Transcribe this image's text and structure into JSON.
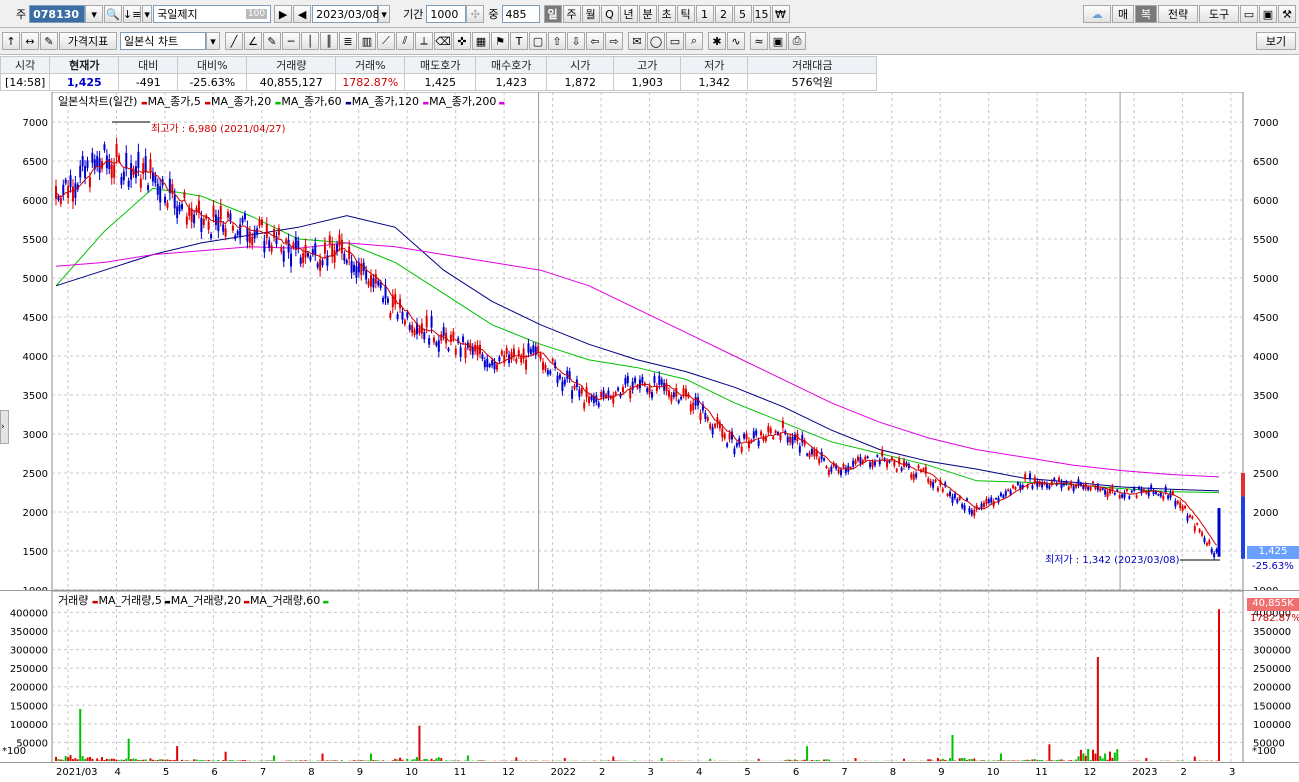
{
  "toolbar1": {
    "market_prefix": "주",
    "code": "078130",
    "name": "국일제지",
    "name_badge": "100",
    "date": "2023/03/08",
    "period_label": "기간",
    "period": "1000",
    "count_label": "중",
    "count": "485",
    "timeframes": [
      "일",
      "주",
      "월",
      "Q",
      "년",
      "분",
      "초",
      "틱",
      "1",
      "2",
      "5",
      "15",
      "₩"
    ],
    "active_timeframe": "일",
    "right_buttons": {
      "cloud": "☁",
      "sell": "매",
      "dup": "복",
      "strategy": "전략",
      "tools": "도구"
    }
  },
  "toolbar2": {
    "indicator_btn": "가격지표",
    "chart_type": "일본식 차트",
    "view_btn": "보기"
  },
  "quote": {
    "headers": [
      "시각",
      "현재가",
      "대비",
      "대비%",
      "거래량",
      "거래%",
      "매도호가",
      "매수호가",
      "시가",
      "고가",
      "저가",
      "거래대금"
    ],
    "values": [
      "[14:58]",
      "1,425",
      "-491",
      "-25.63%",
      "40,855,127",
      "1782.87%",
      "1,425",
      "1,423",
      "1,872",
      "1,903",
      "1,342",
      "576억원"
    ]
  },
  "price_panel": {
    "legend_title": "일본식차트(일간)",
    "legend_items": [
      {
        "label": "MA_종가,5",
        "color": "#d00000"
      },
      {
        "label": "MA_종가,20",
        "color": "#d00000"
      },
      {
        "label": "MA_종가,60",
        "color": "#00c000"
      },
      {
        "label": "MA_종가,120",
        "color": "#000080"
      },
      {
        "label": "MA_종가,200",
        "color": "#e000e0"
      }
    ],
    "high_annotation": "최고가 : 6,980 (2021/04/27)",
    "low_annotation": "최저가 : 1,342 (2023/03/08)",
    "y_ticks": [
      7000,
      6500,
      6000,
      5500,
      5000,
      4500,
      4000,
      3500,
      3000,
      2500,
      2000,
      1500,
      1000
    ],
    "current_price_tag": "1,425",
    "current_change_tag": "-25.63%"
  },
  "volume_panel": {
    "legend_title": "거래량",
    "legend_items": [
      {
        "label": "MA_거래량,5",
        "color": "#d00000"
      },
      {
        "label": "MA_거래량,20",
        "color": "#000000"
      },
      {
        "label": "MA_거래량,60",
        "color": "#d00000"
      },
      {
        "label": "",
        "color": "#00c000"
      }
    ],
    "y_ticks": [
      400000,
      350000,
      300000,
      250000,
      200000,
      150000,
      100000,
      50000
    ],
    "unit_label": "*100",
    "volume_tag": "40,855K",
    "volume_pct_tag": "1782.87%"
  },
  "x_axis": {
    "labels": [
      "2021/03",
      "4",
      "5",
      "6",
      "7",
      "8",
      "9",
      "10",
      "11",
      "12",
      "2022",
      "2",
      "3",
      "4",
      "5",
      "6",
      "7",
      "8",
      "9",
      "10",
      "11",
      "12",
      "2023",
      "2",
      "3"
    ]
  },
  "colors": {
    "up": "#e00000",
    "down": "#0000cc",
    "ma5": "#d00000",
    "ma60": "#00c000",
    "ma120": "#000080",
    "ma200": "#e000e0",
    "grid": "#c8c8c8"
  },
  "chart_data": {
    "type": "line",
    "title": "",
    "xlabel": "",
    "ylabel": "",
    "ylim": [
      1000,
      7000
    ],
    "x": [
      "2021/03",
      "2021/04",
      "2021/05",
      "2021/06",
      "2021/07",
      "2021/08",
      "2021/09",
      "2021/10",
      "2021/11",
      "2021/12",
      "2022/01",
      "2022/02",
      "2022/03",
      "2022/04",
      "2022/05",
      "2022/06",
      "2022/07",
      "2022/08",
      "2022/09",
      "2022/10",
      "2022/11",
      "2022/12",
      "2023/01",
      "2023/02",
      "2023/03"
    ],
    "series": [
      {
        "name": "종가",
        "values": [
          6100,
          6500,
          6300,
          5700,
          5650,
          5300,
          5350,
          4600,
          4200,
          3950,
          4000,
          3400,
          3650,
          3500,
          2850,
          3050,
          2550,
          2700,
          2450,
          2000,
          2400,
          2350,
          2250,
          2250,
          1425
        ]
      },
      {
        "name": "MA_종가,60",
        "values": [
          4900,
          5600,
          6150,
          6050,
          5800,
          5500,
          5450,
          5200,
          4800,
          4400,
          4150,
          3950,
          3850,
          3700,
          3400,
          3150,
          2900,
          2750,
          2600,
          2400,
          2380,
          2350,
          2300,
          2260,
          2250
        ]
      },
      {
        "name": "MA_종가,120",
        "values": [
          4900,
          5100,
          5300,
          5450,
          5550,
          5650,
          5800,
          5650,
          5100,
          4700,
          4400,
          4150,
          3950,
          3800,
          3600,
          3350,
          3050,
          2800,
          2650,
          2550,
          2430,
          2380,
          2320,
          2290,
          2270
        ]
      },
      {
        "name": "MA_종가,200",
        "values": [
          5150,
          5200,
          5300,
          5350,
          5400,
          5380,
          5450,
          5400,
          5300,
          5200,
          5100,
          4900,
          4600,
          4300,
          4000,
          3700,
          3400,
          3150,
          2950,
          2800,
          2700,
          2600,
          2530,
          2480,
          2450
        ]
      }
    ],
    "volume": {
      "unit": "*100",
      "ylim": [
        0,
        420000
      ],
      "values": [
        140000,
        60000,
        40000,
        25000,
        15000,
        20000,
        20000,
        95000,
        15000,
        10000,
        8000,
        12000,
        8000,
        6000,
        6000,
        40000,
        8000,
        6000,
        70000,
        20000,
        45000,
        280000,
        8000,
        12000,
        408551
      ]
    }
  }
}
